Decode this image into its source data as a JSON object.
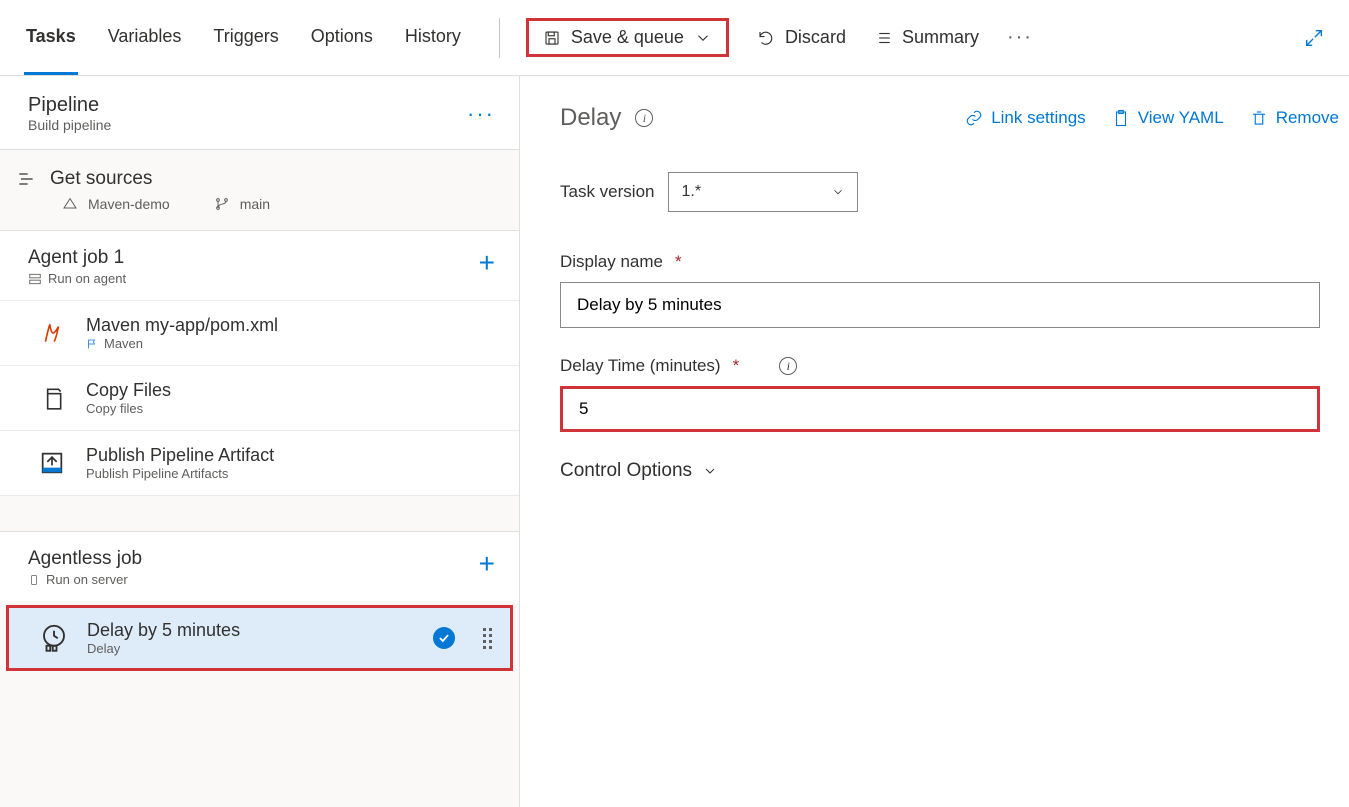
{
  "tabs": {
    "tasks": "Tasks",
    "variables": "Variables",
    "triggers": "Triggers",
    "options": "Options",
    "history": "History"
  },
  "toolbar": {
    "save_queue": "Save & queue",
    "discard": "Discard",
    "summary": "Summary"
  },
  "pipeline": {
    "title": "Pipeline",
    "subtitle": "Build pipeline"
  },
  "sources": {
    "title": "Get sources",
    "repo": "Maven-demo",
    "branch": "main"
  },
  "agent_job": {
    "title": "Agent job 1",
    "subtitle": "Run on agent"
  },
  "tasks_list": {
    "maven": {
      "title": "Maven my-app/pom.xml",
      "subtitle": "Maven"
    },
    "copy": {
      "title": "Copy Files",
      "subtitle": "Copy files"
    },
    "publish": {
      "title": "Publish Pipeline Artifact",
      "subtitle": "Publish Pipeline Artifacts"
    }
  },
  "agentless_job": {
    "title": "Agentless job",
    "subtitle": "Run on server"
  },
  "selected_task": {
    "title": "Delay by 5 minutes",
    "subtitle": "Delay"
  },
  "right": {
    "title": "Delay",
    "links": {
      "settings": "Link settings",
      "yaml": "View YAML",
      "remove": "Remove"
    },
    "task_version_label": "Task version",
    "task_version_value": "1.*",
    "display_name_label": "Display name",
    "display_name_value": "Delay by 5 minutes",
    "delay_time_label": "Delay Time (minutes)",
    "delay_time_value": "5",
    "control_options": "Control Options"
  }
}
